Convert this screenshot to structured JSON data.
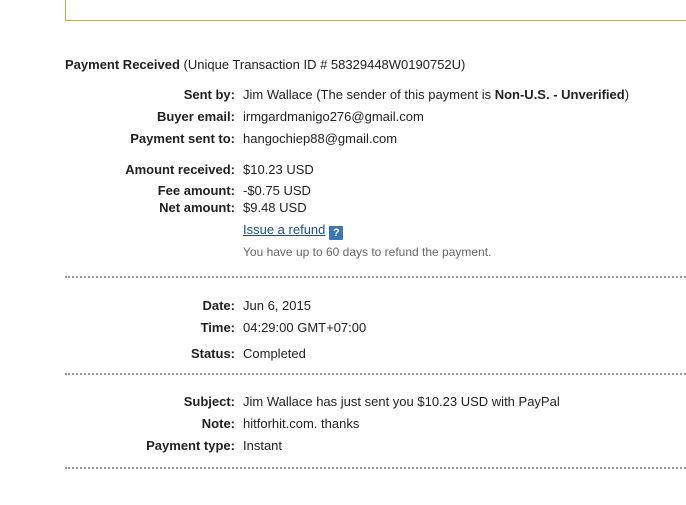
{
  "header": {
    "title": "Payment Received",
    "transaction_text": "(Unique Transaction ID # 58329448W0190752U)"
  },
  "details": {
    "sent_by": {
      "label": "Sent by:",
      "name": "Jim Wallace",
      "status_prefix": "(The sender of this payment is ",
      "status": "Non-U.S. - Unverified",
      "status_suffix": ")"
    },
    "buyer_email": {
      "label": "Buyer email:",
      "value": "irmgardmanigo276@gmail.com"
    },
    "payment_sent_to": {
      "label": "Payment sent to:",
      "value": "hangochiep88@gmail.com"
    },
    "amount_received": {
      "label": "Amount received:",
      "value": "$10.23 USD"
    },
    "fee_amount": {
      "label": "Fee amount:",
      "value": "-$0.75 USD"
    },
    "net_amount": {
      "label": "Net amount:",
      "value": "$9.48 USD"
    },
    "refund": {
      "link_label": "Issue a refund",
      "help_icon": "?",
      "note": "You have up to 60 days to refund the payment."
    }
  },
  "timing": {
    "date": {
      "label": "Date:",
      "value": "Jun 6, 2015"
    },
    "time": {
      "label": "Time:",
      "value": "04:29:00 GMT+07:00"
    },
    "status": {
      "label": "Status:",
      "value": "Completed"
    }
  },
  "message": {
    "subject": {
      "label": "Subject:",
      "value": "Jim Wallace has just sent you $10.23 USD with PayPal"
    },
    "note": {
      "label": "Note:",
      "value": "hitforhit.com. thanks"
    },
    "payment_type": {
      "label": "Payment type:",
      "value": "Instant"
    }
  },
  "colors": {
    "accent_border": "#a9c23f",
    "link": "#1a4f8b",
    "help_icon_bg": "#3d76b7",
    "divider": "#999999"
  }
}
